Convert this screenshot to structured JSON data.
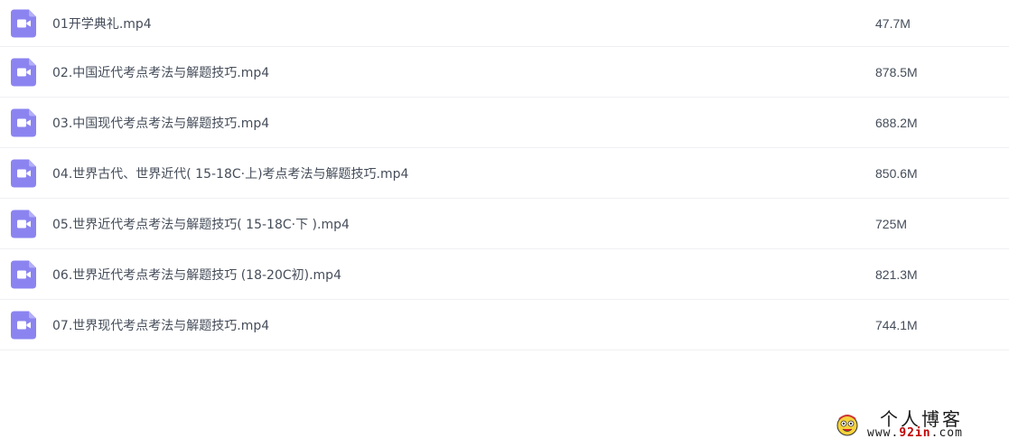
{
  "files": [
    {
      "name": "01开学典礼.mp4",
      "size": "47.7M",
      "icon": "video-file-icon"
    },
    {
      "name": "02.中国近代考点考法与解题技巧.mp4",
      "size": "878.5M",
      "icon": "video-file-icon"
    },
    {
      "name": "03.中国现代考点考法与解题技巧.mp4",
      "size": "688.2M",
      "icon": "video-file-icon"
    },
    {
      "name": "04.世界古代、世界近代( 15-18C·上)考点考法与解题技巧.mp4",
      "size": "850.6M",
      "icon": "video-file-icon"
    },
    {
      "name": "05.世界近代考点考法与解题技巧( 15-18C·下 ).mp4",
      "size": "725M",
      "icon": "video-file-icon"
    },
    {
      "name": "06.世界近代考点考法与解题技巧 (18-20C初).mp4",
      "size": "821.3M",
      "icon": "video-file-icon"
    },
    {
      "name": "07.世界现代考点考法与解题技巧.mp4",
      "size": "744.1M",
      "icon": "video-file-icon"
    }
  ],
  "watermark": {
    "title": "个人博客",
    "url_prefix": "www.",
    "url_highlight": "92in",
    "url_suffix": ".com"
  },
  "colors": {
    "icon": "#8b84f0",
    "text": "#454d5a",
    "divider": "#f0f0f3",
    "watermark_highlight": "#c00000"
  }
}
